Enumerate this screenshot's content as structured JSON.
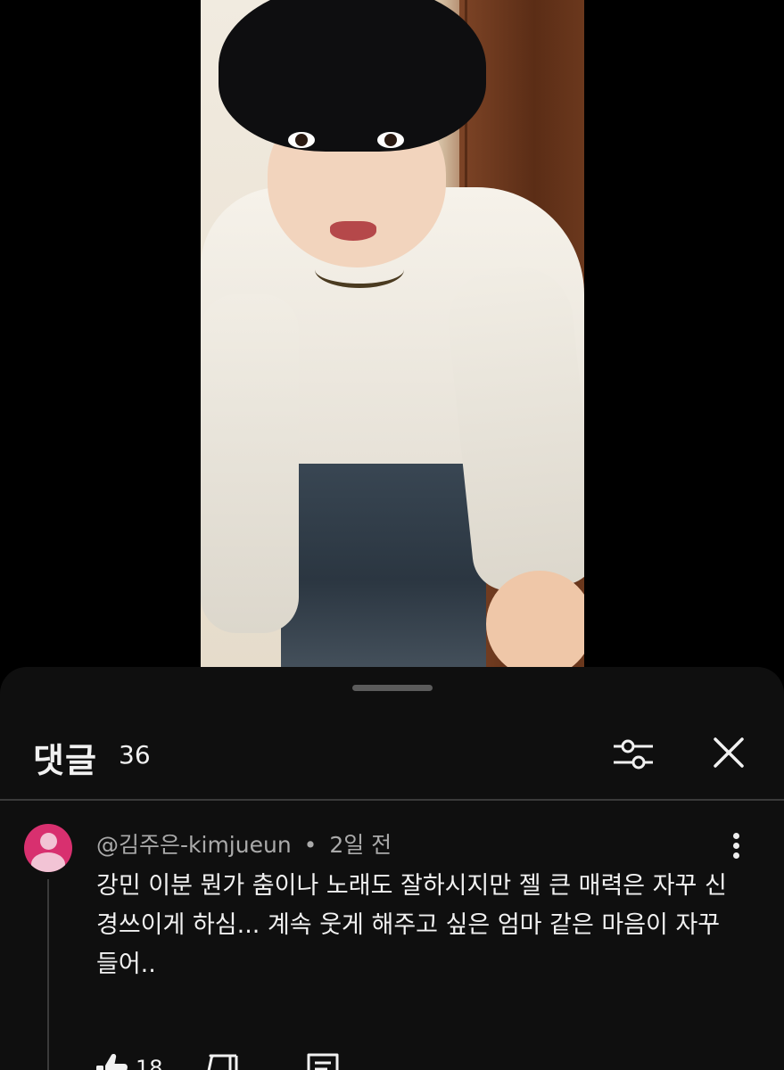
{
  "sheet": {
    "title": "댓글",
    "count": "36"
  },
  "comment": {
    "author": "@김주은-kimjueun",
    "separator": "•",
    "time": "2일 전",
    "text": "강민 이분 뭔가 춤이나 노래도 잘하시지만 젤 큰 매력은 자꾸 신경쓰이게 하심... 계속 웃게 해주고 싶은 엄마 같은 마음이 자꾸 들어..",
    "likes": "18"
  },
  "icons": {
    "filter": "sliders-icon",
    "close": "close-icon",
    "more": "more-vertical-icon",
    "like": "thumbs-up-icon",
    "dislike": "thumbs-down-icon",
    "reply": "comment-icon"
  },
  "colors": {
    "sheet_bg": "#0f0f0f",
    "avatar": "#d8306f",
    "text_primary": "#f1f1f1",
    "text_secondary": "#aaaaaa"
  }
}
